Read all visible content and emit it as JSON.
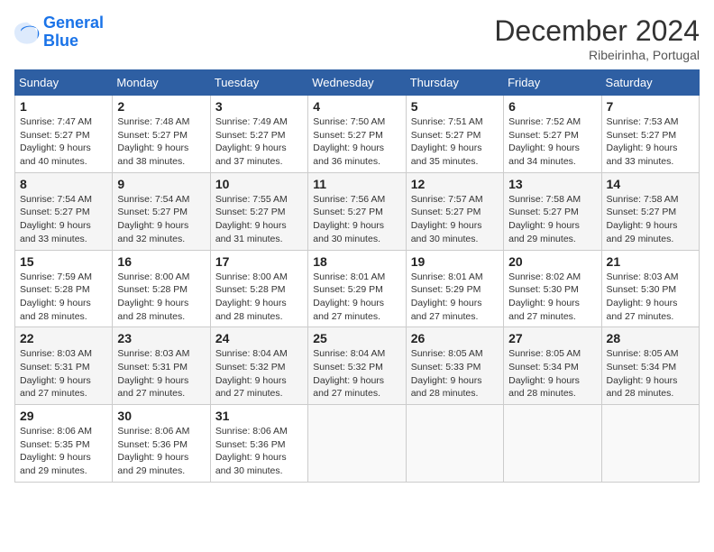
{
  "logo": {
    "line1": "General",
    "line2": "Blue"
  },
  "title": "December 2024",
  "location": "Ribeirinha, Portugal",
  "days_header": [
    "Sunday",
    "Monday",
    "Tuesday",
    "Wednesday",
    "Thursday",
    "Friday",
    "Saturday"
  ],
  "weeks": [
    [
      {
        "day": "1",
        "info": "Sunrise: 7:47 AM\nSunset: 5:27 PM\nDaylight: 9 hours and 40 minutes."
      },
      {
        "day": "2",
        "info": "Sunrise: 7:48 AM\nSunset: 5:27 PM\nDaylight: 9 hours and 38 minutes."
      },
      {
        "day": "3",
        "info": "Sunrise: 7:49 AM\nSunset: 5:27 PM\nDaylight: 9 hours and 37 minutes."
      },
      {
        "day": "4",
        "info": "Sunrise: 7:50 AM\nSunset: 5:27 PM\nDaylight: 9 hours and 36 minutes."
      },
      {
        "day": "5",
        "info": "Sunrise: 7:51 AM\nSunset: 5:27 PM\nDaylight: 9 hours and 35 minutes."
      },
      {
        "day": "6",
        "info": "Sunrise: 7:52 AM\nSunset: 5:27 PM\nDaylight: 9 hours and 34 minutes."
      },
      {
        "day": "7",
        "info": "Sunrise: 7:53 AM\nSunset: 5:27 PM\nDaylight: 9 hours and 33 minutes."
      }
    ],
    [
      {
        "day": "8",
        "info": "Sunrise: 7:54 AM\nSunset: 5:27 PM\nDaylight: 9 hours and 33 minutes."
      },
      {
        "day": "9",
        "info": "Sunrise: 7:54 AM\nSunset: 5:27 PM\nDaylight: 9 hours and 32 minutes."
      },
      {
        "day": "10",
        "info": "Sunrise: 7:55 AM\nSunset: 5:27 PM\nDaylight: 9 hours and 31 minutes."
      },
      {
        "day": "11",
        "info": "Sunrise: 7:56 AM\nSunset: 5:27 PM\nDaylight: 9 hours and 30 minutes."
      },
      {
        "day": "12",
        "info": "Sunrise: 7:57 AM\nSunset: 5:27 PM\nDaylight: 9 hours and 30 minutes."
      },
      {
        "day": "13",
        "info": "Sunrise: 7:58 AM\nSunset: 5:27 PM\nDaylight: 9 hours and 29 minutes."
      },
      {
        "day": "14",
        "info": "Sunrise: 7:58 AM\nSunset: 5:27 PM\nDaylight: 9 hours and 29 minutes."
      }
    ],
    [
      {
        "day": "15",
        "info": "Sunrise: 7:59 AM\nSunset: 5:28 PM\nDaylight: 9 hours and 28 minutes."
      },
      {
        "day": "16",
        "info": "Sunrise: 8:00 AM\nSunset: 5:28 PM\nDaylight: 9 hours and 28 minutes."
      },
      {
        "day": "17",
        "info": "Sunrise: 8:00 AM\nSunset: 5:28 PM\nDaylight: 9 hours and 28 minutes."
      },
      {
        "day": "18",
        "info": "Sunrise: 8:01 AM\nSunset: 5:29 PM\nDaylight: 9 hours and 27 minutes."
      },
      {
        "day": "19",
        "info": "Sunrise: 8:01 AM\nSunset: 5:29 PM\nDaylight: 9 hours and 27 minutes."
      },
      {
        "day": "20",
        "info": "Sunrise: 8:02 AM\nSunset: 5:30 PM\nDaylight: 9 hours and 27 minutes."
      },
      {
        "day": "21",
        "info": "Sunrise: 8:03 AM\nSunset: 5:30 PM\nDaylight: 9 hours and 27 minutes."
      }
    ],
    [
      {
        "day": "22",
        "info": "Sunrise: 8:03 AM\nSunset: 5:31 PM\nDaylight: 9 hours and 27 minutes."
      },
      {
        "day": "23",
        "info": "Sunrise: 8:03 AM\nSunset: 5:31 PM\nDaylight: 9 hours and 27 minutes."
      },
      {
        "day": "24",
        "info": "Sunrise: 8:04 AM\nSunset: 5:32 PM\nDaylight: 9 hours and 27 minutes."
      },
      {
        "day": "25",
        "info": "Sunrise: 8:04 AM\nSunset: 5:32 PM\nDaylight: 9 hours and 27 minutes."
      },
      {
        "day": "26",
        "info": "Sunrise: 8:05 AM\nSunset: 5:33 PM\nDaylight: 9 hours and 28 minutes."
      },
      {
        "day": "27",
        "info": "Sunrise: 8:05 AM\nSunset: 5:34 PM\nDaylight: 9 hours and 28 minutes."
      },
      {
        "day": "28",
        "info": "Sunrise: 8:05 AM\nSunset: 5:34 PM\nDaylight: 9 hours and 28 minutes."
      }
    ],
    [
      {
        "day": "29",
        "info": "Sunrise: 8:06 AM\nSunset: 5:35 PM\nDaylight: 9 hours and 29 minutes."
      },
      {
        "day": "30",
        "info": "Sunrise: 8:06 AM\nSunset: 5:36 PM\nDaylight: 9 hours and 29 minutes."
      },
      {
        "day": "31",
        "info": "Sunrise: 8:06 AM\nSunset: 5:36 PM\nDaylight: 9 hours and 30 minutes."
      },
      {
        "day": "",
        "info": ""
      },
      {
        "day": "",
        "info": ""
      },
      {
        "day": "",
        "info": ""
      },
      {
        "day": "",
        "info": ""
      }
    ]
  ]
}
